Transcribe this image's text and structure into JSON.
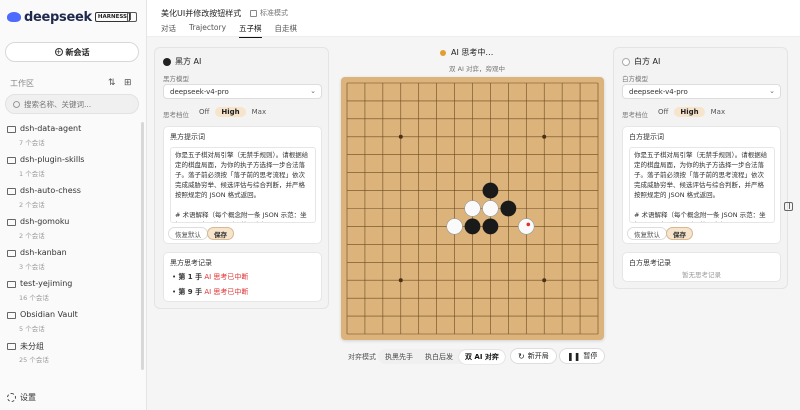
{
  "sidebar": {
    "logo_text": "deepseek",
    "badge": "HARNESS",
    "new_chat": "新会话",
    "workspace_label": "工作区",
    "search_placeholder": "搜索名称、关键词...",
    "folders": [
      {
        "name": "dsh-data-agent",
        "count": "7 个会话"
      },
      {
        "name": "dsh-plugin-skills",
        "count": "1 个会话"
      },
      {
        "name": "dsh-auto-chess",
        "count": "2 个会话"
      },
      {
        "name": "dsh-gomoku",
        "count": "2 个会话"
      },
      {
        "name": "dsh-kanban",
        "count": "3 个会话"
      },
      {
        "name": "test-yejiming",
        "count": "16 个会话"
      },
      {
        "name": "Obsidian Vault",
        "count": "5 个会话"
      },
      {
        "name": "未分组",
        "count": "25 个会话"
      }
    ],
    "settings": "设置"
  },
  "header": {
    "project_title": "美化UI并修改按钮样式",
    "mode_tag": "标准模式",
    "tabs": [
      "对话",
      "Trajectory",
      "五子棋",
      "自走棋"
    ],
    "active_tab": "五子棋"
  },
  "black_panel": {
    "title": "黑方 AI",
    "model_label": "黑方模型",
    "model_value": "deepseek-v4-pro",
    "think_label": "思考档位",
    "think_options": [
      "Off",
      "High",
      "Max"
    ],
    "think_selected": "High",
    "prompt_title": "黑方提示词",
    "prompt_text": "你是五子棋对局引擎（无禁手规则）。请根据给定的棋盘局面，为你的执子方选择一步合法落子。落子前必须按「落子前的思考流程」依次完成威胁穷举、候选评估与综合判断，并严格按照规定的 JSON 格式返回。\n\n# 术语解释（每个概念附一条 JSON 示范：坐标 [x,y] 表示第 x 列、第 y 行）",
    "reset_label": "恢复默认",
    "save_label": "保存",
    "log_title": "黑方思考记录",
    "log_items": [
      {
        "move": "第 1 手",
        "status": "AI 思考已中断"
      },
      {
        "move": "第 9 手",
        "status": "AI 思考已中断"
      }
    ]
  },
  "white_panel": {
    "title": "白方 AI",
    "model_label": "白方模型",
    "model_value": "deepseek-v4-pro",
    "think_label": "思考档位",
    "think_options": [
      "Off",
      "High",
      "Max"
    ],
    "think_selected": "High",
    "prompt_title": "白方提示词",
    "prompt_text": "你是五子棋对局引擎（无禁手规则）。请根据给定的棋盘局面，为你的执子方选择一步合法落子。落子前必须按「落子前的思考流程」依次完成威胁穷举、候选评估与综合判断，并严格按照规定的 JSON 格式返回。\n\n# 术语解释（每个概念附一条 JSON 示范：坐标 [x,y] 表示第 x 列、第 y 行）",
    "reset_label": "恢复默认",
    "save_label": "保存",
    "log_title": "白方思考记录",
    "log_empty": "暂无思考记录"
  },
  "game": {
    "status": "AI 思考中…",
    "status_sub": "双 AI 对弈，旁观中",
    "board_size": 15,
    "star_points": [
      [
        3,
        3
      ],
      [
        11,
        3
      ],
      [
        7,
        7
      ],
      [
        3,
        11
      ],
      [
        11,
        11
      ]
    ],
    "stones": [
      {
        "col": 8,
        "row": 6,
        "color": "black"
      },
      {
        "col": 7,
        "row": 7,
        "color": "white"
      },
      {
        "col": 8,
        "row": 7,
        "color": "white"
      },
      {
        "col": 9,
        "row": 7,
        "color": "black"
      },
      {
        "col": 6,
        "row": 8,
        "color": "white"
      },
      {
        "col": 7,
        "row": 8,
        "color": "black"
      },
      {
        "col": 8,
        "row": 8,
        "color": "black"
      },
      {
        "col": 10,
        "row": 8,
        "color": "white",
        "last": true
      }
    ],
    "mode_label": "对弈模式",
    "modes": [
      "执黑先手",
      "执白后发",
      "双 AI 对弈"
    ],
    "mode_selected": "双 AI 对弈",
    "new_game": "新开局",
    "pause": "暂停"
  },
  "colors": {
    "accent": "#f7e4cc",
    "board": "#dcb37a",
    "danger": "#e03030",
    "brand": "#4d6bfe"
  }
}
